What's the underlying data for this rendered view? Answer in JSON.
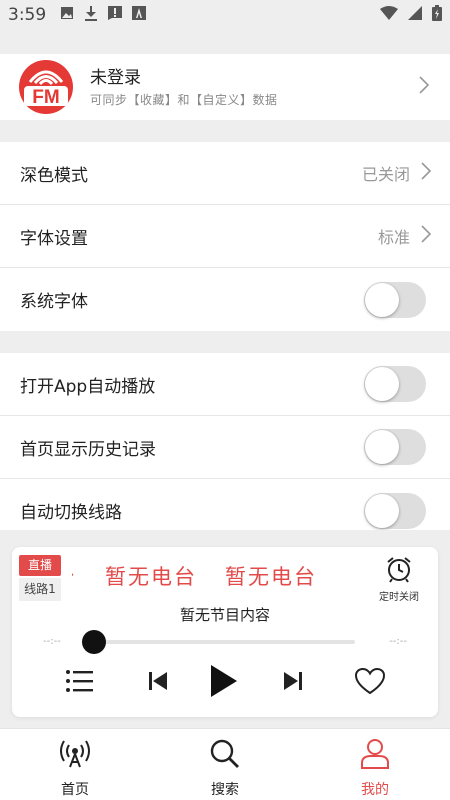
{
  "status_bar": {
    "time": "3:59"
  },
  "user": {
    "title": "未登录",
    "subtitle": "可同步【收藏】和【自定义】数据",
    "logo_text": "FM"
  },
  "settings": {
    "dark_mode": {
      "label": "深色模式",
      "value": "已关闭"
    },
    "font_setting": {
      "label": "字体设置",
      "value": "标准"
    },
    "system_font": {
      "label": "系统字体",
      "enabled": false
    },
    "autoplay": {
      "label": "打开App自动播放",
      "enabled": false
    },
    "history": {
      "label": "首页显示历史记录",
      "enabled": false
    },
    "auto_switch": {
      "label": "自动切换线路",
      "enabled": false
    }
  },
  "player": {
    "live_badge": "直播",
    "line_badge": "线路1",
    "station_text": "暂无电台",
    "marquee_prefix": "台",
    "program": "暂无节目内容",
    "time_start": "--:--",
    "time_end": "--:--",
    "timer_label": "定时关闭",
    "progress": 0
  },
  "bottom_nav": {
    "home": "首页",
    "search": "搜索",
    "mine": "我的",
    "active": "mine"
  },
  "colors": {
    "accent": "#e34b4b",
    "background_gray": "#eeeeee"
  }
}
